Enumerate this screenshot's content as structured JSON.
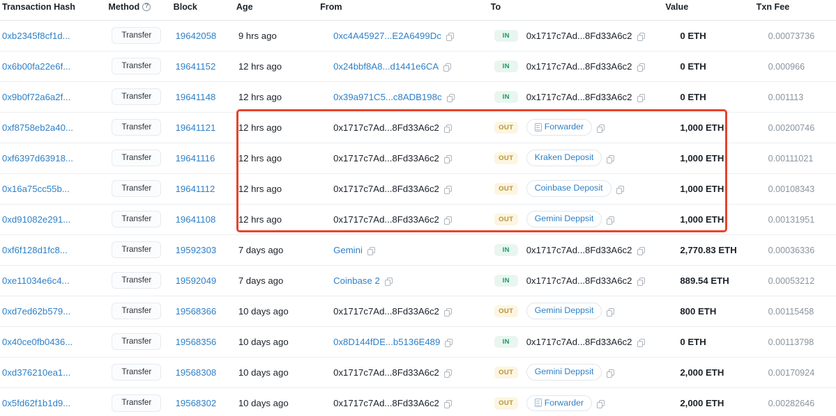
{
  "table": {
    "columns": [
      {
        "key": "hash",
        "label": "Transaction Hash",
        "sortable": false,
        "help": false
      },
      {
        "key": "method",
        "label": "Method",
        "sortable": false,
        "help": true
      },
      {
        "key": "block",
        "label": "Block",
        "sortable": false,
        "help": false
      },
      {
        "key": "age",
        "label": "Age",
        "sortable": true,
        "help": false
      },
      {
        "key": "from",
        "label": "From",
        "sortable": false,
        "help": false
      },
      {
        "key": "to",
        "label": "To",
        "sortable": false,
        "help": false
      },
      {
        "key": "value",
        "label": "Value",
        "sortable": false,
        "help": false
      },
      {
        "key": "fee",
        "label": "Txn Fee",
        "sortable": true,
        "help": false
      }
    ],
    "rows": [
      {
        "hash": "0xb2345f8cf1d...",
        "method": "Transfer",
        "block": "19642058",
        "age": "9 hrs ago",
        "from": "0xc4A45927...E2A6499Dc",
        "from_link": true,
        "from_tag": false,
        "direction": "IN",
        "to": "0x1717c7Ad...8Fd33A6c2",
        "to_link": false,
        "to_tag": false,
        "to_doc": false,
        "value": "0 ETH",
        "fee": "0.00073736",
        "highlighted": false
      },
      {
        "hash": "0x6b00fa22e6f...",
        "method": "Transfer",
        "block": "19641152",
        "age": "12 hrs ago",
        "from": "0x24bbf8A8...d1441e6CA",
        "from_link": true,
        "from_tag": false,
        "direction": "IN",
        "to": "0x1717c7Ad...8Fd33A6c2",
        "to_link": false,
        "to_tag": false,
        "to_doc": false,
        "value": "0 ETH",
        "fee": "0.000966",
        "highlighted": false
      },
      {
        "hash": "0x9b0f72a6a2f...",
        "method": "Transfer",
        "block": "19641148",
        "age": "12 hrs ago",
        "from": "0x39a971C5...c8ADB198c",
        "from_link": true,
        "from_tag": false,
        "direction": "IN",
        "to": "0x1717c7Ad...8Fd33A6c2",
        "to_link": false,
        "to_tag": false,
        "to_doc": false,
        "value": "0 ETH",
        "fee": "0.001113",
        "highlighted": false
      },
      {
        "hash": "0xf8758eb2a40...",
        "method": "Transfer",
        "block": "19641121",
        "age": "12 hrs ago",
        "from": "0x1717c7Ad...8Fd33A6c2",
        "from_link": false,
        "from_tag": false,
        "direction": "OUT",
        "to": "Forwarder",
        "to_link": true,
        "to_tag": true,
        "to_doc": true,
        "value": "1,000 ETH",
        "fee": "0.00200746",
        "highlighted": true
      },
      {
        "hash": "0xf6397d63918...",
        "method": "Transfer",
        "block": "19641116",
        "age": "12 hrs ago",
        "from": "0x1717c7Ad...8Fd33A6c2",
        "from_link": false,
        "from_tag": false,
        "direction": "OUT",
        "to": "Kraken Deposit",
        "to_link": true,
        "to_tag": true,
        "to_doc": false,
        "value": "1,000 ETH",
        "fee": "0.00111021",
        "highlighted": true
      },
      {
        "hash": "0x16a75cc55b...",
        "method": "Transfer",
        "block": "19641112",
        "age": "12 hrs ago",
        "from": "0x1717c7Ad...8Fd33A6c2",
        "from_link": false,
        "from_tag": false,
        "direction": "OUT",
        "to": "Coinbase Deposit",
        "to_link": true,
        "to_tag": true,
        "to_doc": false,
        "value": "1,000 ETH",
        "fee": "0.00108343",
        "highlighted": true
      },
      {
        "hash": "0xd91082e291...",
        "method": "Transfer",
        "block": "19641108",
        "age": "12 hrs ago",
        "from": "0x1717c7Ad...8Fd33A6c2",
        "from_link": false,
        "from_tag": false,
        "direction": "OUT",
        "to": "Gemini Deppsit",
        "to_link": true,
        "to_tag": true,
        "to_doc": false,
        "value": "1,000 ETH",
        "fee": "0.00131951",
        "highlighted": true
      },
      {
        "hash": "0xf6f128d1fc8...",
        "method": "Transfer",
        "block": "19592303",
        "age": "7 days ago",
        "from": "Gemini",
        "from_link": true,
        "from_tag": false,
        "direction": "IN",
        "to": "0x1717c7Ad...8Fd33A6c2",
        "to_link": false,
        "to_tag": false,
        "to_doc": false,
        "value": "2,770.83 ETH",
        "fee": "0.00036336",
        "highlighted": false
      },
      {
        "hash": "0xe11034e6c4...",
        "method": "Transfer",
        "block": "19592049",
        "age": "7 days ago",
        "from": "Coinbase 2",
        "from_link": true,
        "from_tag": false,
        "direction": "IN",
        "to": "0x1717c7Ad...8Fd33A6c2",
        "to_link": false,
        "to_tag": false,
        "to_doc": false,
        "value": "889.54 ETH",
        "fee": "0.00053212",
        "highlighted": false
      },
      {
        "hash": "0xd7ed62b579...",
        "method": "Transfer",
        "block": "19568366",
        "age": "10 days ago",
        "from": "0x1717c7Ad...8Fd33A6c2",
        "from_link": false,
        "from_tag": false,
        "direction": "OUT",
        "to": "Gemini Deppsit",
        "to_link": true,
        "to_tag": true,
        "to_doc": false,
        "value": "800 ETH",
        "fee": "0.00115458",
        "highlighted": false
      },
      {
        "hash": "0x40ce0fb0436...",
        "method": "Transfer",
        "block": "19568356",
        "age": "10 days ago",
        "from": "0x8D144fDE...b5136E489",
        "from_link": true,
        "from_tag": false,
        "direction": "IN",
        "to": "0x1717c7Ad...8Fd33A6c2",
        "to_link": false,
        "to_tag": false,
        "to_doc": false,
        "value": "0 ETH",
        "fee": "0.00113798",
        "highlighted": false
      },
      {
        "hash": "0xd376210ea1...",
        "method": "Transfer",
        "block": "19568308",
        "age": "10 days ago",
        "from": "0x1717c7Ad...8Fd33A6c2",
        "from_link": false,
        "from_tag": false,
        "direction": "OUT",
        "to": "Gemini Deppsit",
        "to_link": true,
        "to_tag": true,
        "to_doc": false,
        "value": "2,000 ETH",
        "fee": "0.00170924",
        "highlighted": false
      },
      {
        "hash": "0x5fd62f1b1d9...",
        "method": "Transfer",
        "block": "19568302",
        "age": "10 days ago",
        "from": "0x1717c7Ad...8Fd33A6c2",
        "from_link": false,
        "from_tag": false,
        "direction": "OUT",
        "to": "Forwarder",
        "to_link": true,
        "to_tag": true,
        "to_doc": true,
        "value": "2,000 ETH",
        "fee": "0.00282646",
        "highlighted": false
      }
    ]
  },
  "annotation": {
    "highlight_color": "#e8432a",
    "highlight_label": "outgoing-1000-eth-transfers"
  },
  "colors": {
    "link": "#2f80c7",
    "in_badge_bg": "#e9f6ef",
    "in_badge_text": "#18996a",
    "out_badge_bg": "#fdf5e0",
    "out_badge_text": "#b89338",
    "fee_text": "#8a949f",
    "row_border": "#eceef1"
  }
}
